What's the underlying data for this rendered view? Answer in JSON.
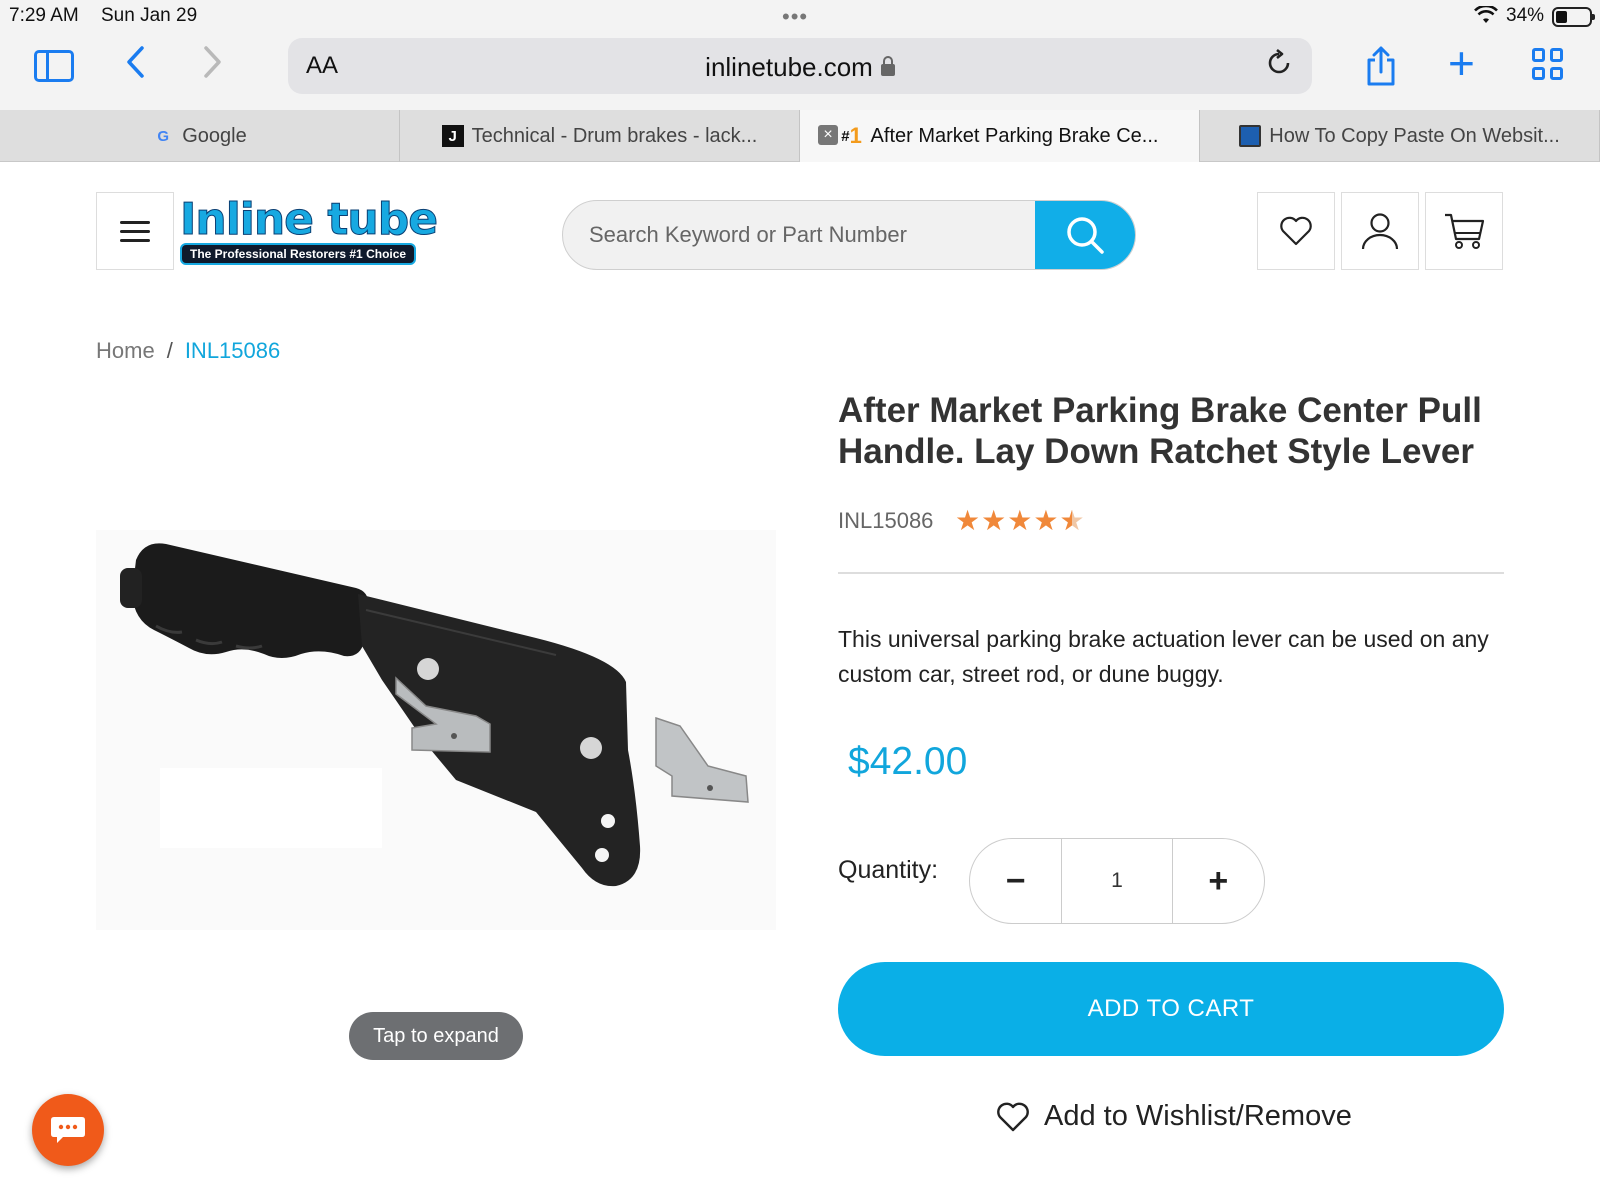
{
  "status_bar": {
    "time": "7:29 AM",
    "date": "Sun Jan 29",
    "battery": "34%"
  },
  "browser": {
    "text_size_label": "AA",
    "url": "inlinetube.com",
    "tabs": [
      {
        "label": "Google",
        "favicon": "google-icon",
        "active": false
      },
      {
        "label": "Technical - Drum brakes - lack...",
        "favicon": "j-icon",
        "active": false
      },
      {
        "label": "After Market Parking Brake Ce...",
        "favicon": "inlinetube-icon",
        "active": true
      },
      {
        "label": "How To Copy Paste On Websit...",
        "favicon": "laptop-icon",
        "active": false
      }
    ]
  },
  "header": {
    "logo_text": "Inline tube",
    "logo_tagline": "The Professional Restorers #1 Choice",
    "search_placeholder": "Search Keyword or Part Number",
    "icons": [
      "heart-icon",
      "user-icon",
      "cart-icon"
    ]
  },
  "breadcrumb": {
    "home": "Home",
    "separator": "/",
    "current": "INL15086"
  },
  "product": {
    "title": "After Market Parking Brake Center Pull Handle. Lay Down Ratchet Style Lever",
    "sku": "INL15086",
    "rating": 4.5,
    "rating_max": 5,
    "description": "This universal parking brake actuation lever can be used on any custom car, street rod, or dune buggy.",
    "price": "$42.00",
    "quantity_label": "Quantity:",
    "quantity": "1",
    "decrement": "−",
    "increment": "+",
    "add_to_cart": "ADD TO CART",
    "wishlist": "Add to Wishlist/Remove",
    "expand_hint": "Tap to expand"
  },
  "colors": {
    "accent": "#0aafe7",
    "star": "#f0883a",
    "chat": "#f05a1a"
  }
}
